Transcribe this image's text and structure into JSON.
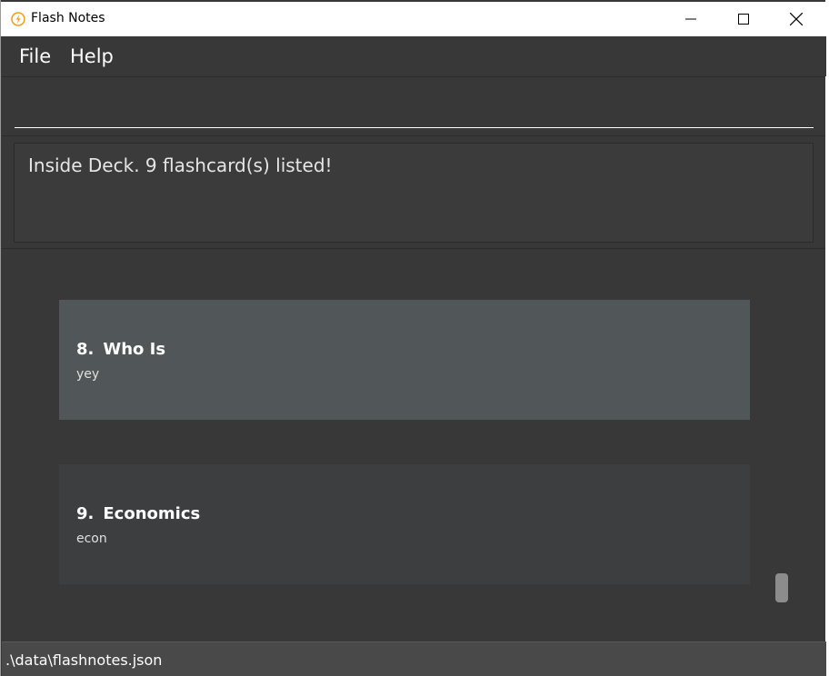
{
  "window": {
    "title": "Flash Notes",
    "icon": "lightning-bolt-icon",
    "accent": "#f0a020"
  },
  "menu": {
    "items": [
      {
        "label": "File"
      },
      {
        "label": "Help"
      }
    ]
  },
  "command": {
    "value": "",
    "placeholder": ""
  },
  "result": {
    "text": "Inside Deck. 9 flashcard(s) listed!"
  },
  "flashcards": [
    {
      "index": "8.",
      "title": "Who Is",
      "subtitle": "yey",
      "selected": true
    },
    {
      "index": "9.",
      "title": "Economics",
      "subtitle": "econ",
      "selected": false
    }
  ],
  "status": {
    "path": ".\\data\\flashnotes.json"
  },
  "colors": {
    "background": "#383838",
    "card_selected": "#515658",
    "card_normal": "#3c3e3f",
    "status_bar": "#494949"
  }
}
